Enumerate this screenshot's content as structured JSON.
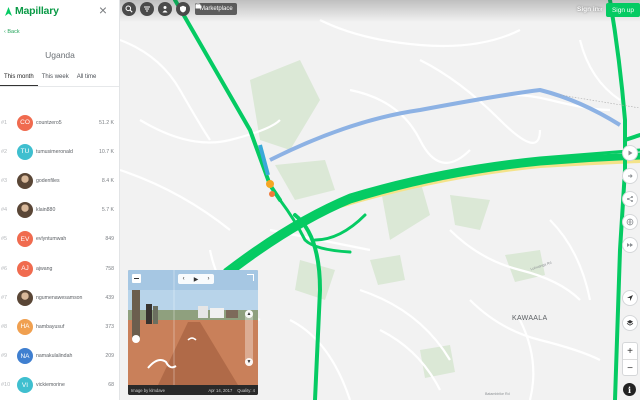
{
  "brand": {
    "name": "Mapillary",
    "accent": "#05cb63"
  },
  "sidebar": {
    "back_label": "Back",
    "region": "Uganda",
    "tabs": [
      {
        "label": "This month",
        "active": true
      },
      {
        "label": "This week",
        "active": false
      },
      {
        "label": "All time",
        "active": false
      }
    ],
    "leaderboard": [
      {
        "rank": "#1",
        "initials": "CO",
        "color": "#f06b4f",
        "name": "countzero5",
        "score": "51.2 K"
      },
      {
        "rank": "#2",
        "initials": "TU",
        "color": "#3fbfcf",
        "name": "tumusimeronald",
        "score": "10.7 K"
      },
      {
        "rank": "#3",
        "initials": "",
        "color": "#6d5a48",
        "name": "godenfiles",
        "score": "8.4 K",
        "photo": true
      },
      {
        "rank": "#4",
        "initials": "",
        "color": "#6d5a48",
        "name": "klain880",
        "score": "5.7 K",
        "photo": true
      },
      {
        "rank": "#5",
        "initials": "EV",
        "color": "#f06b4f",
        "name": "evlyntumwah",
        "score": "849"
      },
      {
        "rank": "#6",
        "initials": "AJ",
        "color": "#f06b4f",
        "name": "ajwang",
        "score": "758"
      },
      {
        "rank": "#7",
        "initials": "",
        "color": "#6d5a48",
        "name": "ngumenawesamson",
        "score": "439",
        "photo": true
      },
      {
        "rank": "#8",
        "initials": "HA",
        "color": "#f0a050",
        "name": "hambayusuf",
        "score": "373"
      },
      {
        "rank": "#9",
        "initials": "NA",
        "color": "#3f7fd0",
        "name": "namakulalindah",
        "score": "209"
      },
      {
        "rank": "#10",
        "initials": "VI",
        "color": "#3fbfcf",
        "name": "vickiemorine",
        "score": "68"
      }
    ]
  },
  "topbar": {
    "marketplace_label": "Marketplace",
    "signin_label": "Sign in",
    "or_label": "or",
    "signup_label": "Sign up"
  },
  "map": {
    "place_label": "KAWAALA",
    "road_labels": [
      "Lukwanga Rd",
      "Batambirike Rd"
    ],
    "icons": [
      "search-icon",
      "filter-icon",
      "person-icon",
      "shield-icon",
      "cart-icon",
      "compass-icon",
      "layers-icon",
      "share-icon",
      "globe-icon",
      "play-icon"
    ],
    "zoom_in": "+",
    "zoom_out": "−",
    "info": "i"
  },
  "viewer": {
    "nav_left": "‹",
    "nav_right": "›",
    "nav_play": "▶",
    "caption_left": "Image by klmdave",
    "date": "Apr 14, 2017",
    "quality": "Quality: 4",
    "up": "▲",
    "down": "▼"
  }
}
